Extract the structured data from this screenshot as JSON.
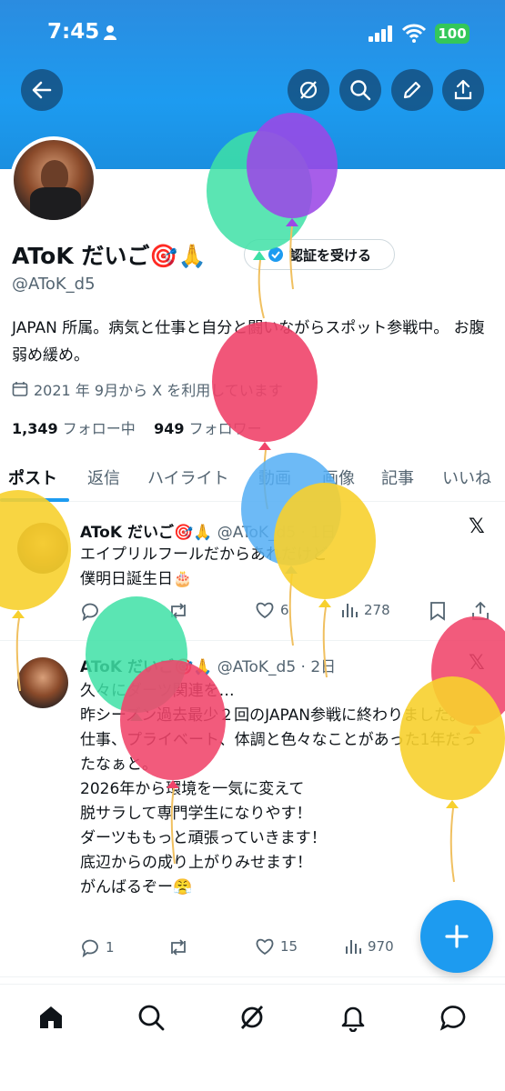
{
  "status_bar": {
    "time": "7:45",
    "battery": "100"
  },
  "header": {
    "back_icon": "arrow-left-icon",
    "actions": [
      "grok-icon",
      "search-icon",
      "edit-icon",
      "share-icon"
    ]
  },
  "profile": {
    "name": "AToK だいご🎯🙏",
    "handle": "@AToK_d5",
    "verify_label": "認証を受ける",
    "bio": "JAPAN 所属。病気と仕事と自分と闘いながらスポット参戦中。 お腹弱め緩め。",
    "joined": "2021 年 9月から X を利用しています",
    "following_count": "1,349",
    "following_label": "フォロー中",
    "followers_count": "949",
    "followers_label": "フォロワー"
  },
  "tabs": [
    "ポスト",
    "返信",
    "ハイライト",
    "動画",
    "画像",
    "記事",
    "いいね"
  ],
  "posts": [
    {
      "author": "AToK だいご🎯🙏",
      "meta": "@AToK_d5 · 1日",
      "text": "エイプリルフールだからあれだけど\n僕明日誕生日🎂",
      "replies": "",
      "reposts": "",
      "likes": "6",
      "views": "278"
    },
    {
      "author": "AToK だいご🎯🙏",
      "meta": "@AToK_d5 · 2日",
      "text": "久々にダーツ関連を…\n昨シーズン過去最少２回のJAPAN参戦に終わりました。\n仕事、プライベート、体調と色々なことがあった1年だったなぁと。\n2026年から環境を一気に変えて\n脱サラして専門学生になりやす！\nダーツももっと頑張っていきます！\n底辺からの成り上がりみせます！\nがんばるぞー😤",
      "replies": "1",
      "reposts": "",
      "likes": "15",
      "views": "970"
    }
  ],
  "bottom_nav": [
    "home-icon",
    "search-icon",
    "grok-icon",
    "notifications-icon",
    "messages-icon"
  ],
  "colors": {
    "accent": "#1d9bf0",
    "banner": "#2b8ce0",
    "text_secondary": "#536471"
  }
}
